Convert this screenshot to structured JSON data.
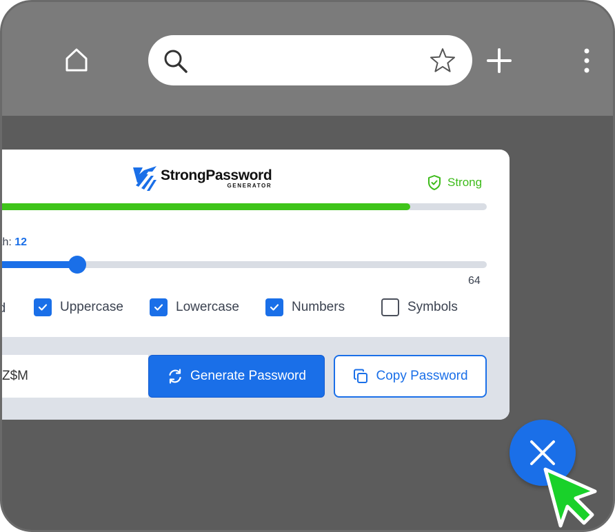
{
  "browser": {
    "search_placeholder": "",
    "icons": {
      "home": "home-icon",
      "search": "search-icon",
      "bookmark": "star-icon",
      "new_tab": "plus-icon",
      "menu": "more-vertical-icon"
    }
  },
  "generator": {
    "logo": {
      "title": "StrongPassword",
      "subtitle": "GENERATOR"
    },
    "strength": {
      "label": "Strong",
      "level": 0.85,
      "color": "#3fc41a"
    },
    "length": {
      "label_partial": "th:",
      "value": "12",
      "max_label": "64",
      "fraction": 0.2
    },
    "options": [
      {
        "label": "ed",
        "checked": null,
        "partial": true
      },
      {
        "label": "Uppercase",
        "checked": true
      },
      {
        "label": "Lowercase",
        "checked": true
      },
      {
        "label": "Numbers",
        "checked": true
      },
      {
        "label": "Symbols",
        "checked": false
      }
    ],
    "password_value": "Z$M",
    "generate_label": "Generate Password",
    "copy_label": "Copy Password",
    "accent_color": "#1a6fe8"
  },
  "overlay": {
    "close_icon": "close-icon",
    "cursor_icon": "pointer-cursor-icon",
    "cursor_color": "#19d12a"
  }
}
